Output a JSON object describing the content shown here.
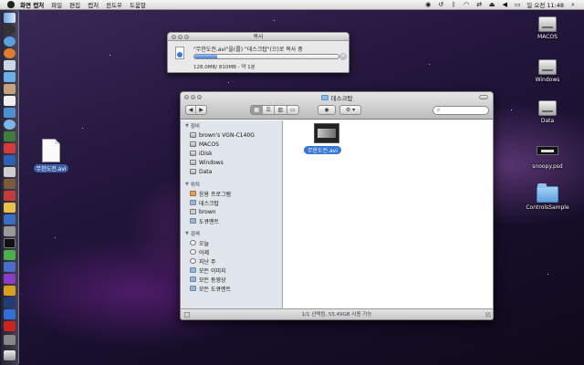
{
  "menubar": {
    "items": [
      "화면 캡처",
      "파일",
      "편집",
      "캡처",
      "윈도우",
      "도움말"
    ],
    "clock": "일 오전 11:48"
  },
  "desktop": {
    "icons": {
      "macos": "MACOS",
      "windows": "Windows",
      "data": "Data",
      "snoopy": "snoopy.psd",
      "controls": "ControlsSample",
      "avi_file": "무한도전.avi"
    }
  },
  "copy_dialog": {
    "title": "복사",
    "status": "\"무한도전.avi\"을(를) \"데스크탑\"(으)로 복사 중",
    "progress": 0.16,
    "detail": "128.0MB/ 810MB - 약 1분"
  },
  "finder": {
    "title": "데스크탑",
    "search_placeholder": "",
    "sidebar": {
      "devices_header": "장비",
      "devices": [
        "brown's VGN-C140G",
        "MACOS",
        "iDisk",
        "Windows",
        "Data"
      ],
      "places_header": "위치",
      "places": [
        "응용 프로그램",
        "데스크탑",
        "brown",
        "도큐멘트"
      ],
      "search_header": "검색",
      "search_for": [
        "오늘",
        "어제",
        "지난 주",
        "모든 이미지",
        "모든 동영상",
        "모든 도큐멘트"
      ]
    },
    "file": {
      "name": "무한도전.avi"
    },
    "status": "1/1 선택됨, 55.49GB 사용 가능"
  },
  "colors": {
    "selection": "#3875d7",
    "progress": "#3b7cd8",
    "sidebar_bg": "#e1e6ec"
  }
}
